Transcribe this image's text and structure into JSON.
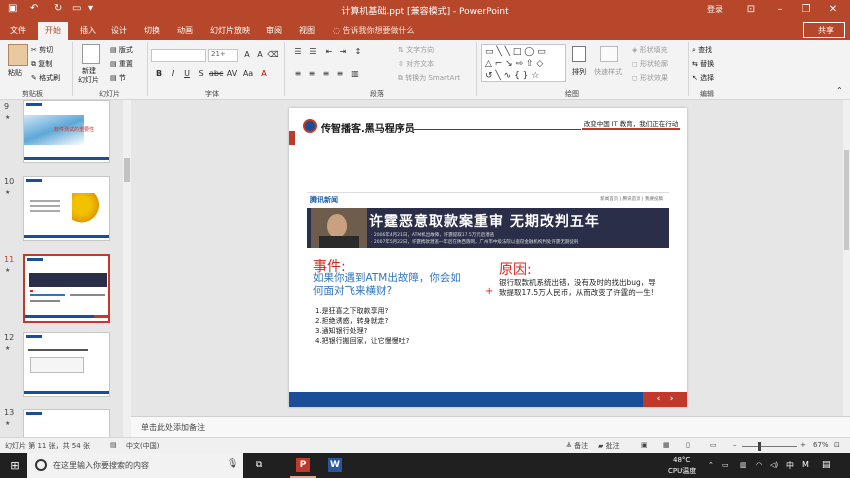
{
  "window": {
    "title": "计算机基础.ppt [兼容模式] - PowerPoint",
    "login": "登录"
  },
  "ribbon": {
    "tabs": [
      "文件",
      "开始",
      "插入",
      "设计",
      "切换",
      "动画",
      "幻灯片放映",
      "审阅",
      "视图"
    ],
    "active_tab": "开始",
    "tell_me": "告诉我你想要做什么",
    "share": "共享",
    "clipboard": {
      "paste": "粘贴",
      "cut": "剪切",
      "copy": "复制",
      "format_painter": "格式刷",
      "label": "剪贴板"
    },
    "slides": {
      "new_slide": "新建",
      "new_slide2": "幻灯片",
      "layout": "版式",
      "reset": "重置",
      "section": "节",
      "label": "幻灯片"
    },
    "font": {
      "name": "",
      "size": "21+",
      "label": "字体"
    },
    "paragraph": {
      "text_direction": "文字方向",
      "align_text": "对齐文本",
      "smartart": "转换为 SmartArt",
      "label": "段落"
    },
    "drawing": {
      "arrange": "排列",
      "quick_styles": "快速样式",
      "shape_fill": "形状填充",
      "shape_outline": "形状轮廓",
      "shape_effects": "形状效果",
      "label": "绘图"
    },
    "editing": {
      "find": "查找",
      "replace": "替换",
      "select": "选择",
      "label": "编辑"
    }
  },
  "thumbnails": [
    {
      "num": "9",
      "caption": "软件测试的重要性"
    },
    {
      "num": "10",
      "caption": ""
    },
    {
      "num": "11",
      "caption": ""
    },
    {
      "num": "12",
      "caption": ""
    },
    {
      "num": "13",
      "caption": ""
    }
  ],
  "selected_slide": "11",
  "slide": {
    "header_title": "传智播客.黑马程序员",
    "slogan": "改变中国 IT 教育，我们正在行动",
    "banner": {
      "site": "腾讯新闻",
      "nav": "新闻首页 | 腾讯首页 | 我要投稿",
      "headline": "许霆恶意取款案重审  无期改判五年",
      "line1": "· 2006年4月21日，ATM机出故障，许霆提取17.5万元后潜逃",
      "line2": "· 2007年5月22日，许霆携款潜逃一年后在陕西落网，广州市中级法院以盗窃金融机构判处许霆无期徒刑"
    },
    "event_title": "事件:",
    "event_question": "如果你遇到ATM出故障，你会如何面对飞来横财?",
    "event_items": [
      "1.是狂喜之下取款享用?",
      "2.拒绝诱惑，转身就走?",
      "3.通知银行处理?",
      "4.把银行搬回家，让它慢慢吐?"
    ],
    "cause_title": "原因:",
    "cause_text": "银行取款机系统出错，没有及时的找出bug，导致提取17.5万人民币，从而改变了许霆的一生!"
  },
  "notes_placeholder": "单击此处添加备注",
  "status": {
    "slide_info": "幻灯片 第 11 张，共 54 张",
    "language": "中文(中国)",
    "notes": "备注",
    "comments": "批注",
    "zoom": "67%"
  },
  "taskbar": {
    "search_placeholder": "在这里输入你要搜索的内容",
    "temp": "48°C",
    "temp_label": "CPU温度",
    "ime": "中",
    "lang": "M"
  }
}
